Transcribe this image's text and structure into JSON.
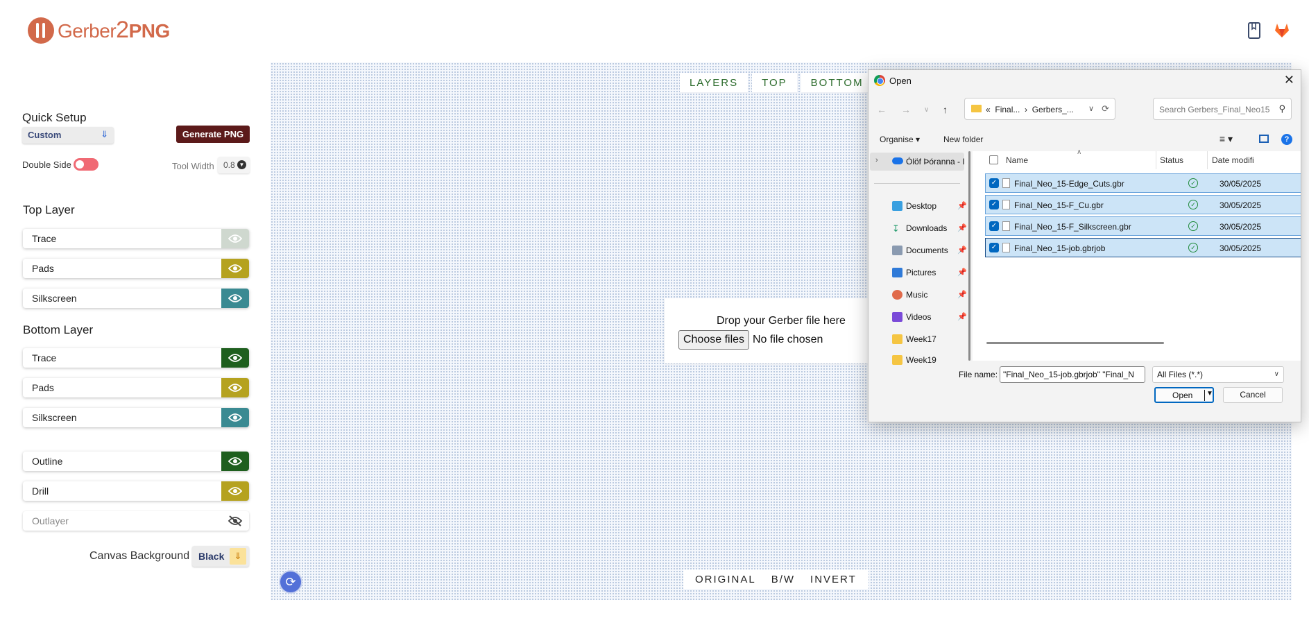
{
  "header": {
    "logo_name": "Gerber",
    "logo_two": "2",
    "logo_png": "PNG",
    "icons": [
      "book-icon",
      "gitlab-icon"
    ]
  },
  "quick_setup": {
    "title": "Quick Setup",
    "preset": "Custom",
    "generate_label": "Generate PNG",
    "double_side_label": "Double Side",
    "double_side_on": false,
    "tool_width_label": "Tool Width",
    "tool_width_value": "0.8"
  },
  "top_layer": {
    "title": "Top Layer",
    "layers": [
      {
        "label": "Trace",
        "color": "#cfd8cf"
      },
      {
        "label": "Pads",
        "color": "#b5a21f"
      },
      {
        "label": "Silkscreen",
        "color": "#3a8a92"
      }
    ]
  },
  "bottom_layer": {
    "title": "Bottom Layer",
    "layers": [
      {
        "label": "Trace",
        "color": "#1e5f1e"
      },
      {
        "label": "Pads",
        "color": "#b5a21f"
      },
      {
        "label": "Silkscreen",
        "color": "#3a8a92"
      }
    ]
  },
  "extra_layers": [
    {
      "label": "Outline",
      "color": "#1e5f1e"
    },
    {
      "label": "Drill",
      "color": "#b5a21f"
    }
  ],
  "outlayer_label": "Outlayer",
  "canvas_background": {
    "label": "Canvas Background",
    "value": "Black"
  },
  "canvas": {
    "top_tabs": [
      "LAYERS",
      "TOP",
      "BOTTOM"
    ],
    "bottom_tabs": [
      "ORIGINAL",
      "B/W",
      "INVERT"
    ],
    "drop_text": "Drop your Gerber file here",
    "choose_label": "Choose files",
    "no_file": "No file chosen"
  },
  "dialog": {
    "title": "Open",
    "breadcrumb": [
      "«",
      "Final...",
      "›",
      "Gerbers_..."
    ],
    "search_placeholder": "Search Gerbers_Final_Neo15",
    "organise": "Organise",
    "new_folder": "New folder",
    "nav_items": [
      {
        "label": "Ólöf Þóranna - I",
        "icon": "onedrive-icon",
        "color": "#1a73e8",
        "pinned": false
      },
      {
        "label": "Desktop",
        "icon": "desktop-icon",
        "color": "#3aa0e0",
        "pinned": true
      },
      {
        "label": "Downloads",
        "icon": "download-icon",
        "color": "#1f9a6a",
        "pinned": true
      },
      {
        "label": "Documents",
        "icon": "documents-icon",
        "color": "#8a9ab0",
        "pinned": true
      },
      {
        "label": "Pictures",
        "icon": "pictures-icon",
        "color": "#2f7ad8",
        "pinned": true
      },
      {
        "label": "Music",
        "icon": "music-icon",
        "color": "#e06a4a",
        "pinned": true
      },
      {
        "label": "Videos",
        "icon": "videos-icon",
        "color": "#7a4ad8",
        "pinned": true
      },
      {
        "label": "Week17",
        "icon": "folder-icon",
        "color": "#f5c542",
        "pinned": false
      },
      {
        "label": "Week19",
        "icon": "folder-icon",
        "color": "#f5c542",
        "pinned": false
      }
    ],
    "columns": [
      "Name",
      "Status",
      "Date modifi"
    ],
    "files": [
      {
        "name": "Final_Neo_15-Edge_Cuts.gbr",
        "date": "30/05/2025"
      },
      {
        "name": "Final_Neo_15-F_Cu.gbr",
        "date": "30/05/2025"
      },
      {
        "name": "Final_Neo_15-F_Silkscreen.gbr",
        "date": "30/05/2025"
      },
      {
        "name": "Final_Neo_15-job.gbrjob",
        "date": "30/05/2025"
      }
    ],
    "file_name_label": "File name:",
    "file_name_value": "\"Final_Neo_15-job.gbrjob\" \"Final_N",
    "file_type": "All Files (*.*)",
    "open_label": "Open",
    "cancel_label": "Cancel"
  }
}
